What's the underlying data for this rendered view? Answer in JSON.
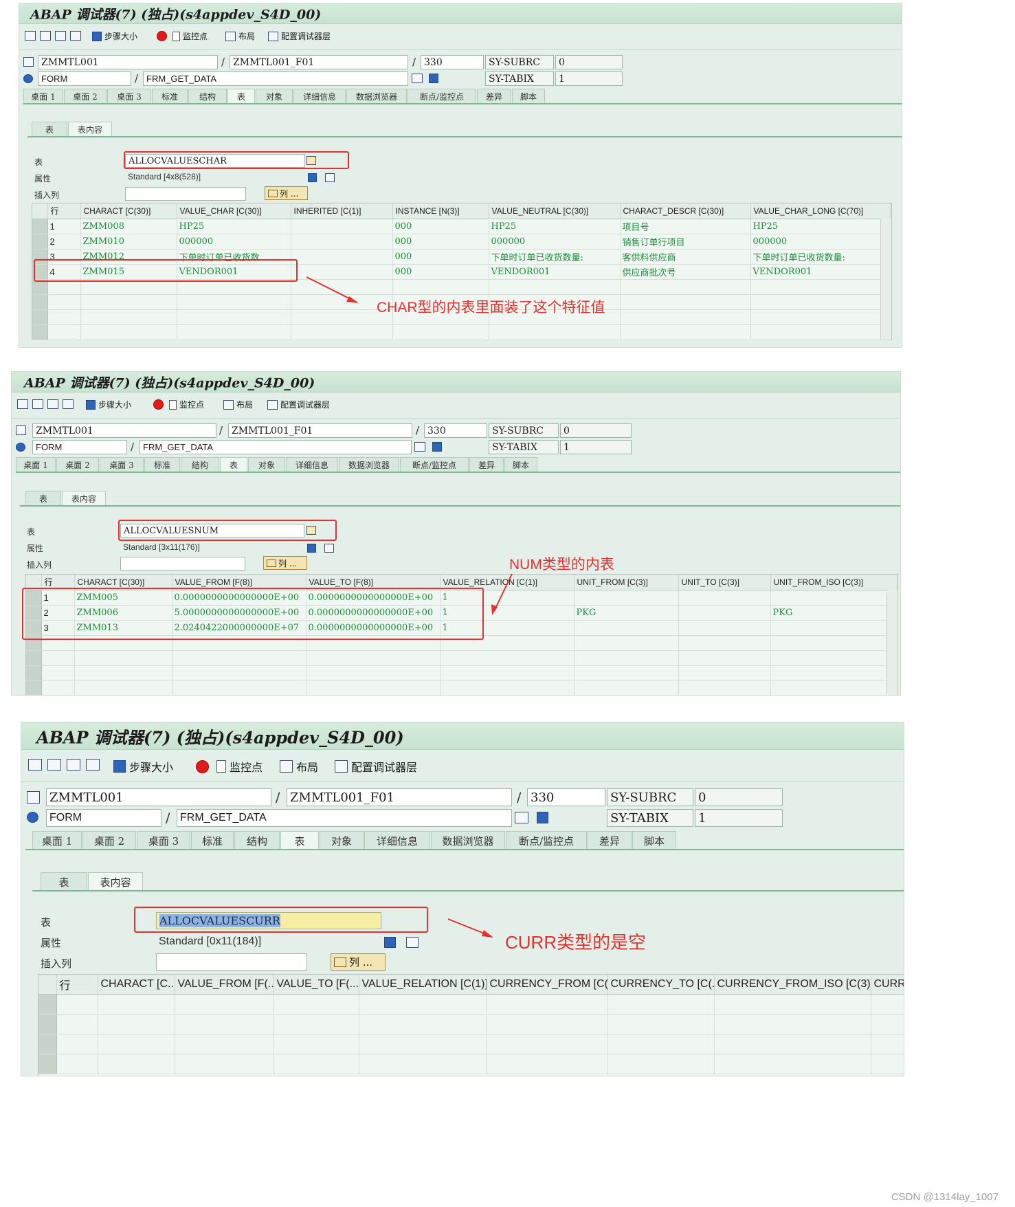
{
  "window": {
    "title": "ABAP 调试器(7) (独占)(s4appdev_S4D_00)"
  },
  "toolbar": {
    "step_size": "步骤大小",
    "watchpoint": "监控点",
    "layout": "布局",
    "config_layer": "配置调试器层"
  },
  "header": {
    "program": "ZMMTL001",
    "include": "ZMMTL001_F01",
    "line": "330",
    "event_type": "FORM",
    "event_name": "FRM_GET_DATA",
    "sy_subrc_label": "SY-SUBRC",
    "sy_subrc_value": "0",
    "sy_tabix_label": "SY-TABIX",
    "sy_tabix_value": "1"
  },
  "tabs": [
    "桌面 1",
    "桌面 2",
    "桌面 3",
    "标准",
    "结构",
    "表",
    "对象",
    "详细信息",
    "数据浏览器",
    "断点/监控点",
    "差异",
    "脚本"
  ],
  "subtabs": [
    "表",
    "表内容"
  ],
  "labels": {
    "table": "表",
    "attributes": "属性",
    "insert_column": "插入列",
    "columns_button": "列 ...",
    "row": "行"
  },
  "panel1": {
    "table_name": "ALLOCVALUESCHAR",
    "attributes": "Standard [4x8(528)]",
    "columns": [
      "CHARACT [C(30)]",
      "VALUE_CHAR [C(30)]",
      "INHERITED [C(1)]",
      "INSTANCE [N(3)]",
      "VALUE_NEUTRAL [C(30)]",
      "CHARACT_DESCR [C(30)]",
      "VALUE_CHAR_LONG [C(70)]"
    ],
    "rows": [
      [
        "1",
        "ZMM008",
        "HP25",
        "",
        "000",
        "HP25",
        "项目号",
        "HP25"
      ],
      [
        "2",
        "ZMM010",
        "000000",
        "",
        "000",
        "000000",
        "销售订单行项目",
        "000000"
      ],
      [
        "3",
        "ZMM012",
        "下单时订单已收货数",
        "",
        "000",
        "下单时订单已收货数量:",
        "客供料供应商",
        "下单时订单已收货数量:"
      ],
      [
        "4",
        "ZMM015",
        "VENDOR001",
        "",
        "000",
        "VENDOR001",
        "供应商批次号",
        "VENDOR001"
      ]
    ],
    "annotation": "CHAR型的内表里面装了这个特征值"
  },
  "panel2": {
    "table_name": "ALLOCVALUESNUM",
    "attributes": "Standard [3x11(176)]",
    "columns": [
      "CHARACT [C(30)]",
      "VALUE_FROM [F(8)]",
      "VALUE_TO [F(8)]",
      "VALUE_RELATION [C(1)]",
      "UNIT_FROM [C(3)]",
      "UNIT_TO [C(3)]",
      "UNIT_FROM_ISO [C(3)]"
    ],
    "rows": [
      [
        "1",
        "ZMM005",
        "0.0000000000000000E+00",
        "0.0000000000000000E+00",
        "1",
        "",
        "",
        ""
      ],
      [
        "2",
        "ZMM006",
        "5.0000000000000000E+00",
        "0.0000000000000000E+00",
        "1",
        "PKG",
        "",
        "PKG"
      ],
      [
        "3",
        "ZMM013",
        "2.0240422000000000E+07",
        "0.0000000000000000E+00",
        "1",
        "",
        "",
        ""
      ]
    ],
    "annotation": "NUM类型的内表"
  },
  "panel3": {
    "table_name": "ALLOCVALUESCURR",
    "attributes": "Standard [0x11(184)]",
    "columns": [
      "CHARACT [C...",
      "VALUE_FROM [F(...",
      "VALUE_TO [F(...",
      "VALUE_RELATION [C(1)]",
      "CURRENCY_FROM [C(...",
      "CURRENCY_TO [C(...",
      "CURRENCY_FROM_ISO [C(3)]",
      "CURRE"
    ],
    "annotation": "CURR类型的是空"
  },
  "footer": {
    "watermark": "CSDN @1314lay_1007"
  },
  "colors": {
    "panel_bg": "#e3efe8",
    "value_green": "#1d8a3c",
    "annotation_red": "#e53030"
  }
}
